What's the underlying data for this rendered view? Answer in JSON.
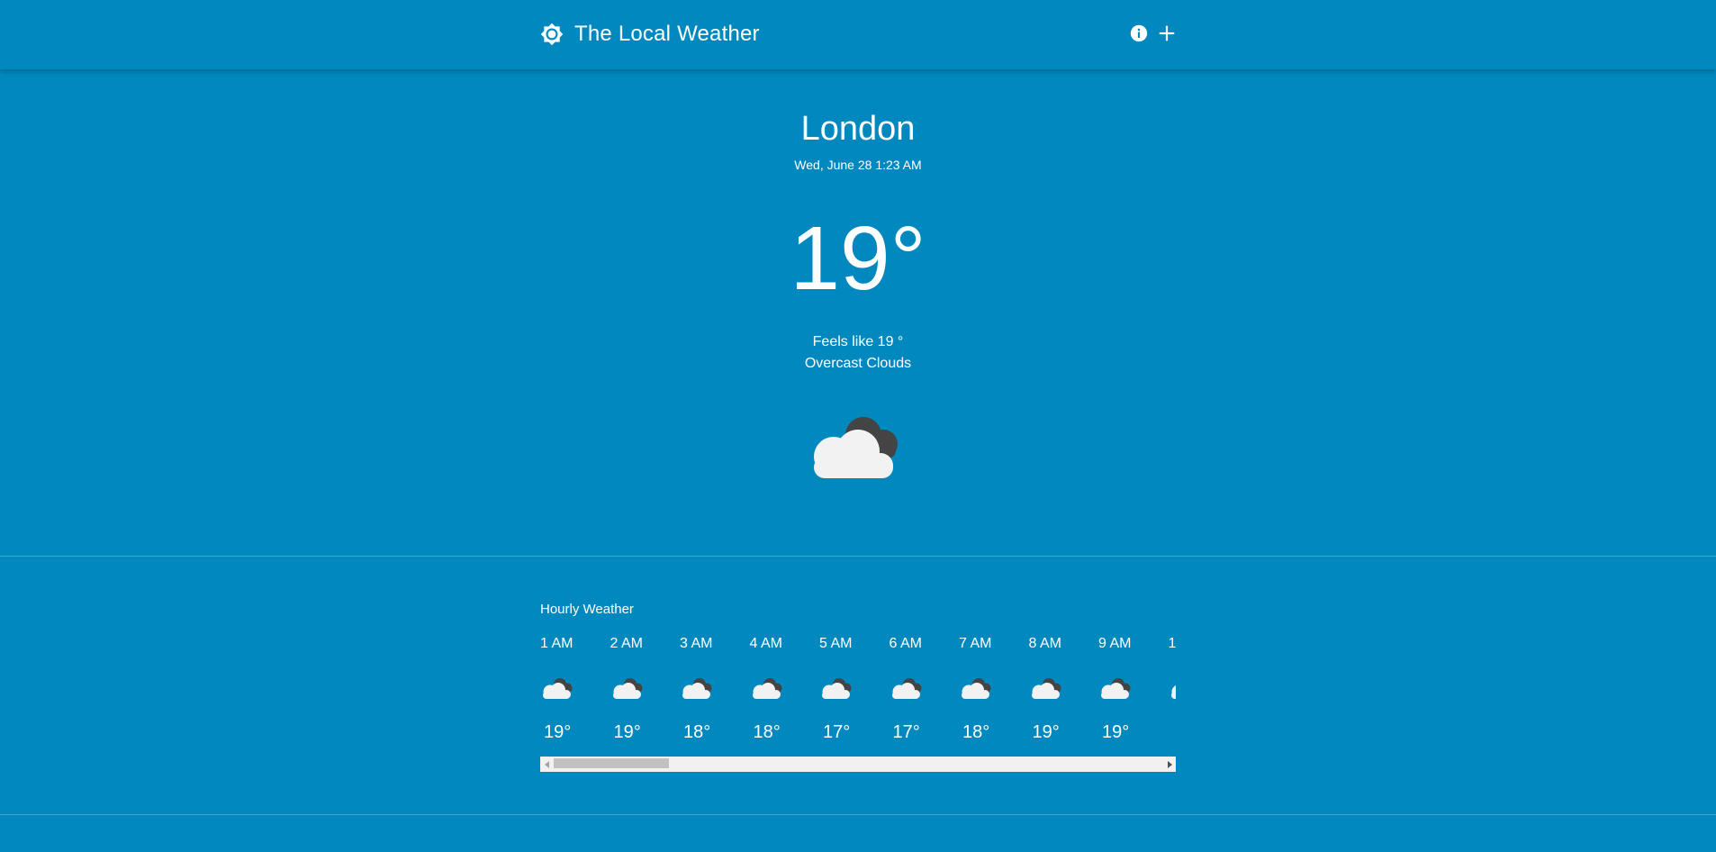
{
  "app": {
    "title": "The Local Weather"
  },
  "current": {
    "city": "London",
    "datetime": "Wed, June 28 1:23 AM",
    "temperature": "19°",
    "feels_like": "Feels like 19 °",
    "description": "Overcast Clouds",
    "icon": "overcast-clouds-icon"
  },
  "hourly": {
    "title": "Hourly Weather",
    "items": [
      {
        "time": "1 AM",
        "temp": "19°",
        "icon": "overcast-clouds-icon"
      },
      {
        "time": "2 AM",
        "temp": "19°",
        "icon": "overcast-clouds-icon"
      },
      {
        "time": "3 AM",
        "temp": "18°",
        "icon": "overcast-clouds-icon"
      },
      {
        "time": "4 AM",
        "temp": "18°",
        "icon": "overcast-clouds-icon"
      },
      {
        "time": "5 AM",
        "temp": "17°",
        "icon": "overcast-clouds-icon"
      },
      {
        "time": "6 AM",
        "temp": "17°",
        "icon": "overcast-clouds-icon"
      },
      {
        "time": "7 AM",
        "temp": "18°",
        "icon": "overcast-clouds-icon"
      },
      {
        "time": "8 AM",
        "temp": "19°",
        "icon": "overcast-clouds-icon"
      },
      {
        "time": "9 AM",
        "temp": "19°",
        "icon": "overcast-clouds-icon"
      },
      {
        "time": "1",
        "temp": "",
        "icon": "overcast-clouds-icon"
      }
    ]
  },
  "colors": {
    "background": "#0189bf",
    "cloud_light": "#f2f2f2",
    "cloud_dark": "#444444"
  }
}
